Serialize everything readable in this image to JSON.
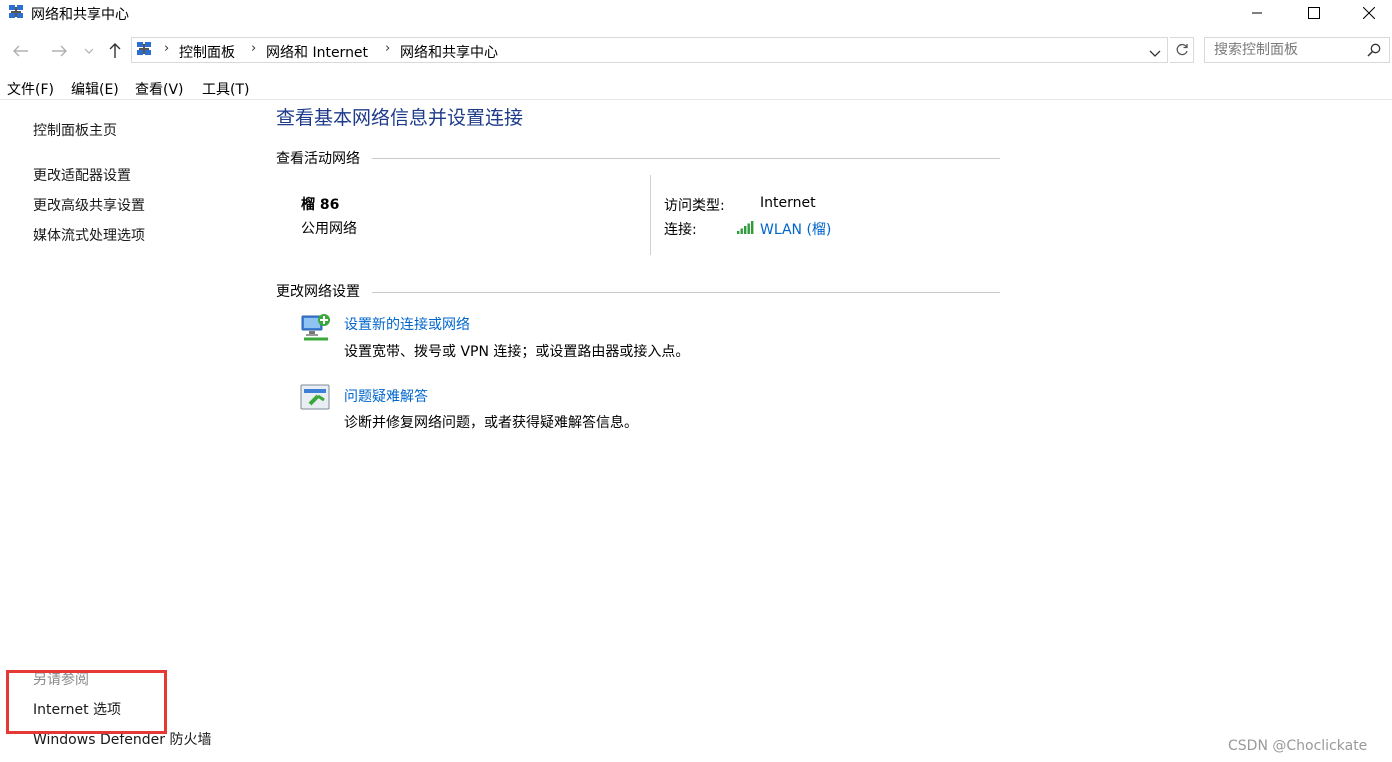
{
  "window": {
    "title": "网络和共享中心",
    "minimize_icon": "minimize-icon",
    "maximize_icon": "maximize-icon",
    "close_icon": "close-icon"
  },
  "navigation": {
    "breadcrumb": [
      "控制面板",
      "网络和 Internet",
      "网络和共享中心"
    ],
    "search_placeholder": "搜索控制面板"
  },
  "menu": [
    "文件(F)",
    "编辑(E)",
    "查看(V)",
    "工具(T)"
  ],
  "sidebar": {
    "links": [
      "控制面板主页",
      "更改适配器设置",
      "更改高级共享设置",
      "媒体流式处理选项"
    ],
    "see_also_label": "另请参阅",
    "see_also_links": [
      "Internet 选项",
      "Windows Defender 防火墙"
    ]
  },
  "main": {
    "heading": "查看基本网络信息并设置连接",
    "active_networks_title": "查看活动网络",
    "network": {
      "name": "榴 86",
      "type": "公用网络",
      "access_type_label": "访问类型:",
      "access_type_value": "Internet",
      "connection_label": "连接:",
      "connection_value": "WLAN (榴)"
    },
    "change_settings_title": "更改网络设置",
    "tasks": [
      {
        "title": "设置新的连接或网络",
        "description": "设置宽带、拨号或 VPN 连接；或设置路由器或接入点。"
      },
      {
        "title": "问题疑难解答",
        "description": "诊断并修复网络问题，或者获得疑难解答信息。"
      }
    ]
  },
  "colors": {
    "heading": "#1e3b8a",
    "link": "#0066cc",
    "highlight_box": "#e53935"
  },
  "watermark": "CSDN @Choclickate"
}
